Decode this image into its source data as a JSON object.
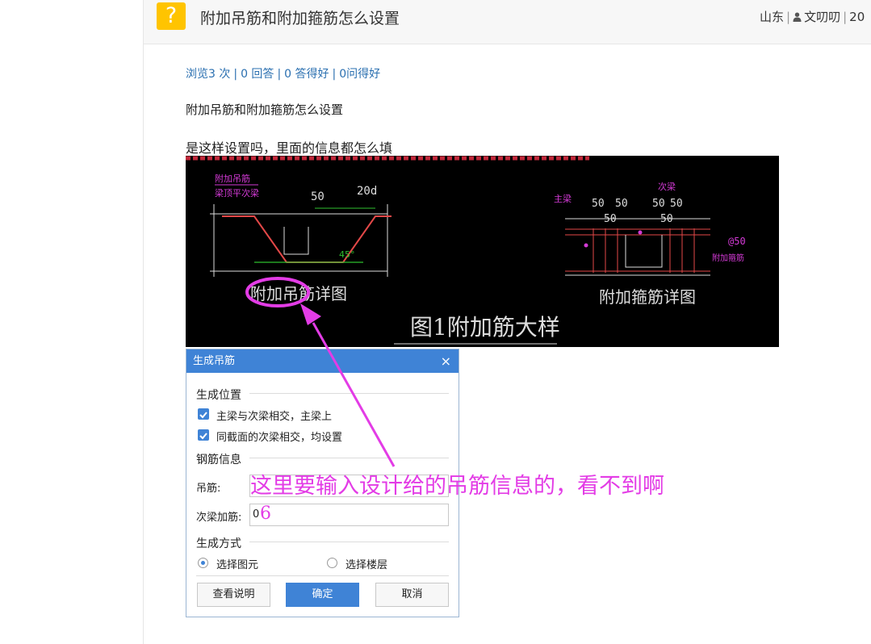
{
  "header": {
    "badge_icon": "?",
    "title": "附加吊筋和附加箍筋怎么设置",
    "region": "山东",
    "separator": "|",
    "user_icon": "user-icon",
    "author": "文叨叨",
    "date_prefix": "20"
  },
  "stats": {
    "views": "浏览3 次",
    "answers": "0 回答",
    "good_answers": "0 答得好",
    "good_questions": "0问得好",
    "separator": "|"
  },
  "post": {
    "line1": "附加吊筋和附加箍筋怎么设置",
    "line2": "是这样设置吗，里面的信息都怎么填"
  },
  "cad": {
    "hanger_label": "附加吊筋详图",
    "stirrup_label": "附加箍筋详图",
    "figure_title": "图1附加筋大样",
    "dim_50": "50",
    "dim_20d": "20d",
    "dim_50b": "50",
    "dim_50c": "50",
    "dim_50d": "50",
    "dim_50e": "50",
    "dim_50f": "50",
    "dim_50g": "50",
    "at50": "@50",
    "main_beam": "主梁",
    "sec_beam": "次梁",
    "side_note": "附加吊筋",
    "side_note2": "梁顶平次梁",
    "right_note": "附加箍筋",
    "deg": "45°"
  },
  "dialog": {
    "title": "生成吊筋",
    "close_icon": "×",
    "section_position": "生成位置",
    "check1": "主梁与次梁相交，主梁上",
    "check2": "同截面的次梁相交，均设置",
    "section_rebar": "钢筋信息",
    "hanger_label": "吊筋:",
    "hanger_value": "",
    "sec_beam_label": "次梁加筋:",
    "sec_beam_value": "0",
    "section_mode": "生成方式",
    "radio1": "选择图元",
    "radio2": "选择楼层",
    "btn_help": "查看说明",
    "btn_ok": "确定",
    "btn_cancel": "取消"
  },
  "annotation": {
    "text": "这里要输入设计给的吊筋信息的，看不到啊",
    "extra_digit": "6",
    "color": "#e33ce6"
  }
}
